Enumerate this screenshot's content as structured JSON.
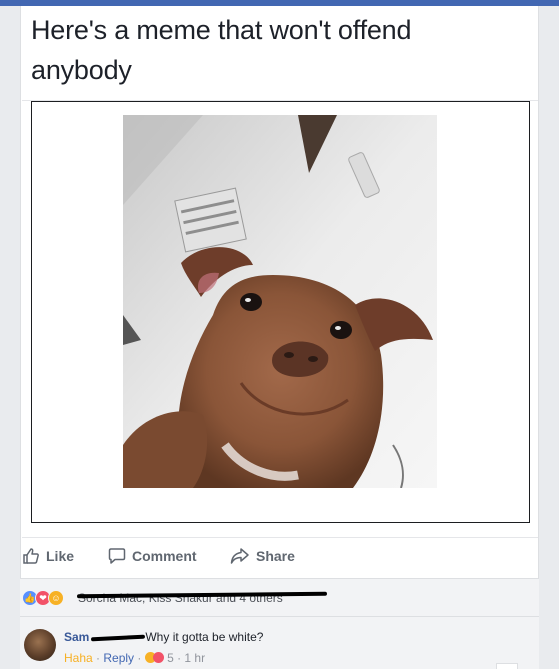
{
  "post": {
    "text": "Here's a meme that won't offend anybody"
  },
  "actions": {
    "like_label": "Like",
    "comment_label": "Comment",
    "share_label": "Share"
  },
  "reactions": {
    "icons": [
      "like-icon",
      "love-icon",
      "haha-icon"
    ],
    "summary": "Sorcha Mac, Kiss Shakur and 4 others"
  },
  "comment": {
    "author": "Sam",
    "text": "Why it gotta be white?",
    "haha_label": "Haha",
    "separator": " · ",
    "reply_label": "Reply",
    "reaction_count": "5",
    "time": "1 hr"
  },
  "colors": {
    "brand": "#4267b2",
    "link": "#385898",
    "haha": "#f7b125",
    "love": "#f25268",
    "like": "#5890ff"
  }
}
